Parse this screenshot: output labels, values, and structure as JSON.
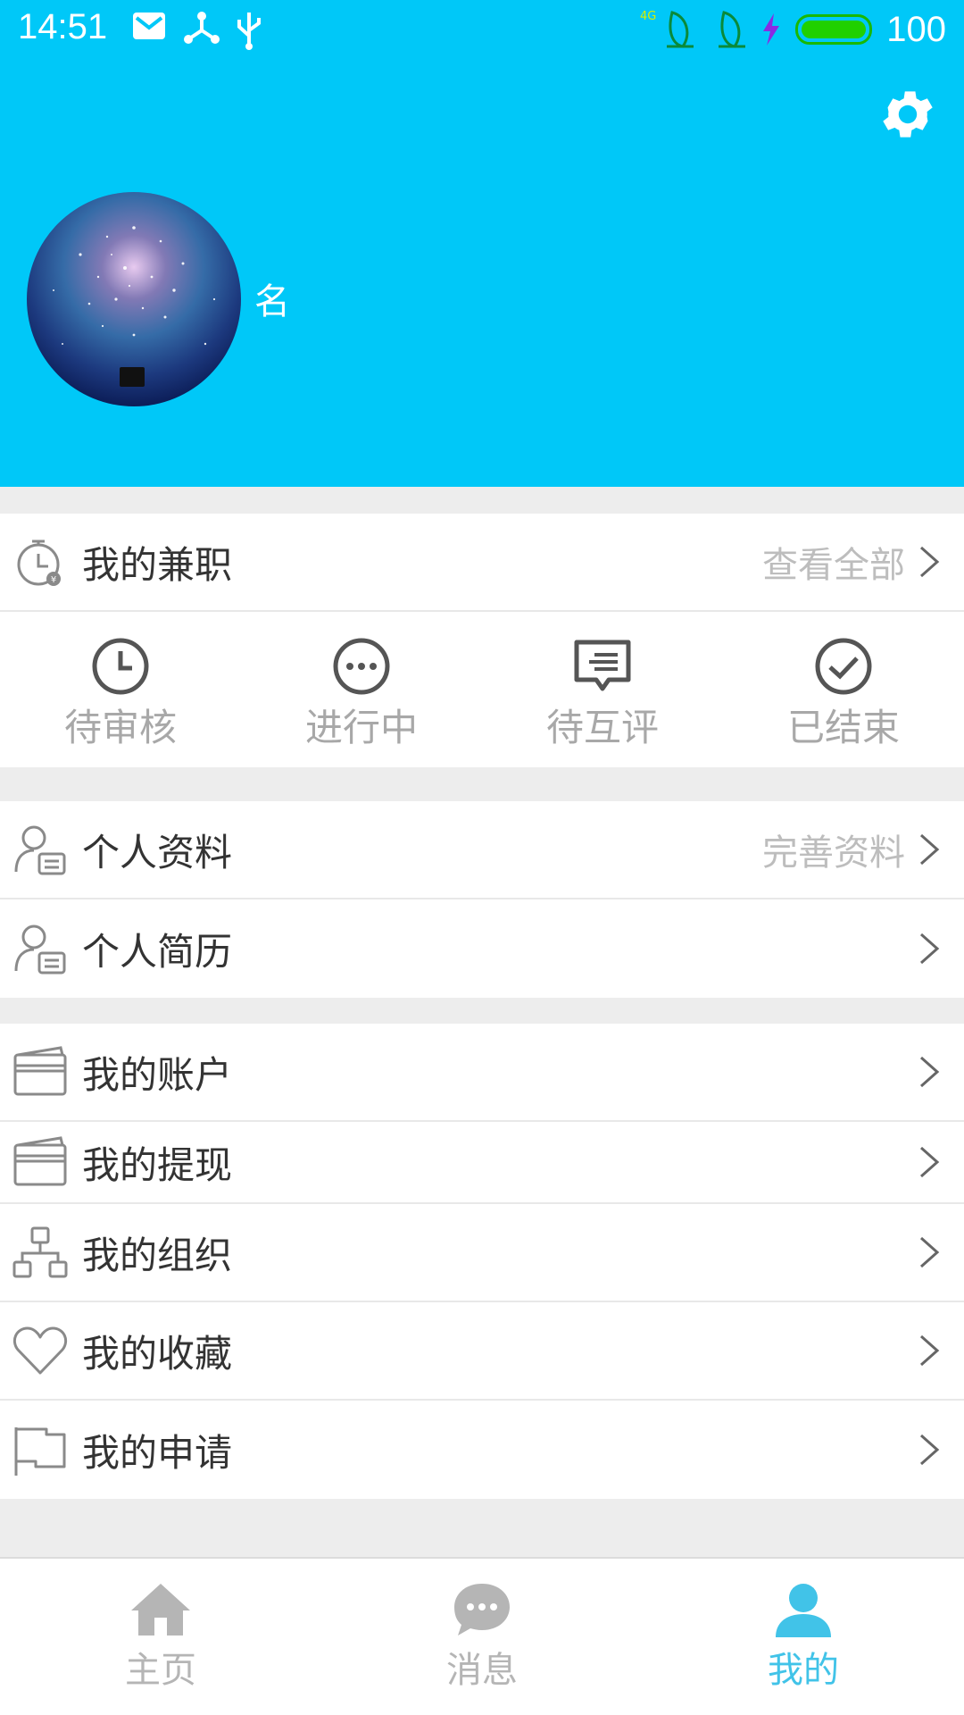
{
  "status_bar": {
    "time": "14:51",
    "battery_level": "100",
    "network": "4G",
    "icons": [
      "mail-icon",
      "share-icon",
      "usb-icon",
      "signal-icon",
      "signal-icon",
      "charging-icon",
      "battery-icon"
    ]
  },
  "profile": {
    "name": "名",
    "settings_icon": "gear-icon"
  },
  "jobs": {
    "title": "我的兼职",
    "view_all": "查看全部",
    "statuses": [
      {
        "label": "待审核",
        "icon": "clock-icon"
      },
      {
        "label": "进行中",
        "icon": "dots-icon"
      },
      {
        "label": "待互评",
        "icon": "comment-icon"
      },
      {
        "label": "已结束",
        "icon": "check-icon"
      }
    ]
  },
  "profile_section": {
    "items": [
      {
        "label": "个人资料",
        "hint": "完善资料",
        "icon": "person-card-icon"
      },
      {
        "label": "个人简历",
        "hint": "",
        "icon": "person-card-icon"
      }
    ]
  },
  "account_section": {
    "items": [
      {
        "label": "我的账户",
        "icon": "card-icon"
      },
      {
        "label": "我的提现",
        "icon": "card-icon"
      },
      {
        "label": "我的组织",
        "icon": "org-icon"
      },
      {
        "label": "我的收藏",
        "icon": "heart-icon"
      },
      {
        "label": "我的申请",
        "icon": "flag-icon"
      }
    ]
  },
  "tabbar": {
    "tabs": [
      {
        "label": "主页",
        "icon": "home-icon",
        "active": false
      },
      {
        "label": "消息",
        "icon": "message-icon",
        "active": false
      },
      {
        "label": "我的",
        "icon": "user-icon",
        "active": true
      }
    ]
  },
  "colors": {
    "header_bg": "#00c8f8",
    "accent": "#41c3e8",
    "text": "#333333",
    "muted": "#a8a8a8"
  }
}
